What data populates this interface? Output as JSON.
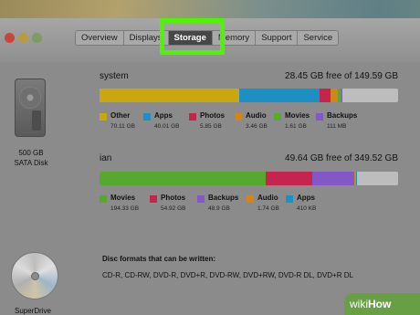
{
  "tabs": [
    {
      "label": "Overview",
      "selected": false
    },
    {
      "label": "Displays",
      "selected": false
    },
    {
      "label": "Storage",
      "selected": true
    },
    {
      "label": "Memory",
      "selected": false
    },
    {
      "label": "Support",
      "selected": false
    },
    {
      "label": "Service",
      "selected": false
    }
  ],
  "disk": {
    "capacity": "500 GB",
    "type": "SATA Disk"
  },
  "volumes": [
    {
      "name": "system",
      "free_text": "28.45 GB free of 149.59 GB",
      "segments": [
        {
          "name": "Other",
          "size": "70.11 GB",
          "gb": 70.11,
          "color": "#c9a80f"
        },
        {
          "name": "Apps",
          "size": "40.01 GB",
          "gb": 40.01,
          "color": "#1c90c4"
        },
        {
          "name": "Photos",
          "size": "5.85 GB",
          "gb": 5.85,
          "color": "#c6234e"
        },
        {
          "name": "Audio",
          "size": "3.46 GB",
          "gb": 3.46,
          "color": "#d0861a"
        },
        {
          "name": "Movies",
          "size": "1.61 GB",
          "gb": 1.61,
          "color": "#56a82f"
        },
        {
          "name": "Backups",
          "size": "111 MB",
          "gb": 0.11,
          "color": "#8457c9"
        }
      ],
      "total_gb": 149.59
    },
    {
      "name": "ian",
      "free_text": "49.64 GB free of 349.52 GB",
      "segments": [
        {
          "name": "Movies",
          "size": "194.33 GB",
          "gb": 194.33,
          "color": "#56a82f"
        },
        {
          "name": "Photos",
          "size": "54.92 GB",
          "gb": 54.92,
          "color": "#c6234e"
        },
        {
          "name": "Backups",
          "size": "48.9 GB",
          "gb": 48.9,
          "color": "#8457c9"
        },
        {
          "name": "Audio",
          "size": "1.74 GB",
          "gb": 1.74,
          "color": "#d0861a"
        },
        {
          "name": "Apps",
          "size": "410 KB",
          "gb": 0.0004,
          "color": "#1c90c4"
        }
      ],
      "total_gb": 349.52
    }
  ],
  "disc": {
    "title": "Disc formats that can be written:",
    "formats": "CD-R, CD-RW, DVD-R, DVD+R, DVD-RW, DVD+RW, DVD-R DL, DVD+R DL",
    "drive_label": "SuperDrive"
  },
  "watermark": {
    "prefix": "wiki",
    "suffix": "How"
  }
}
